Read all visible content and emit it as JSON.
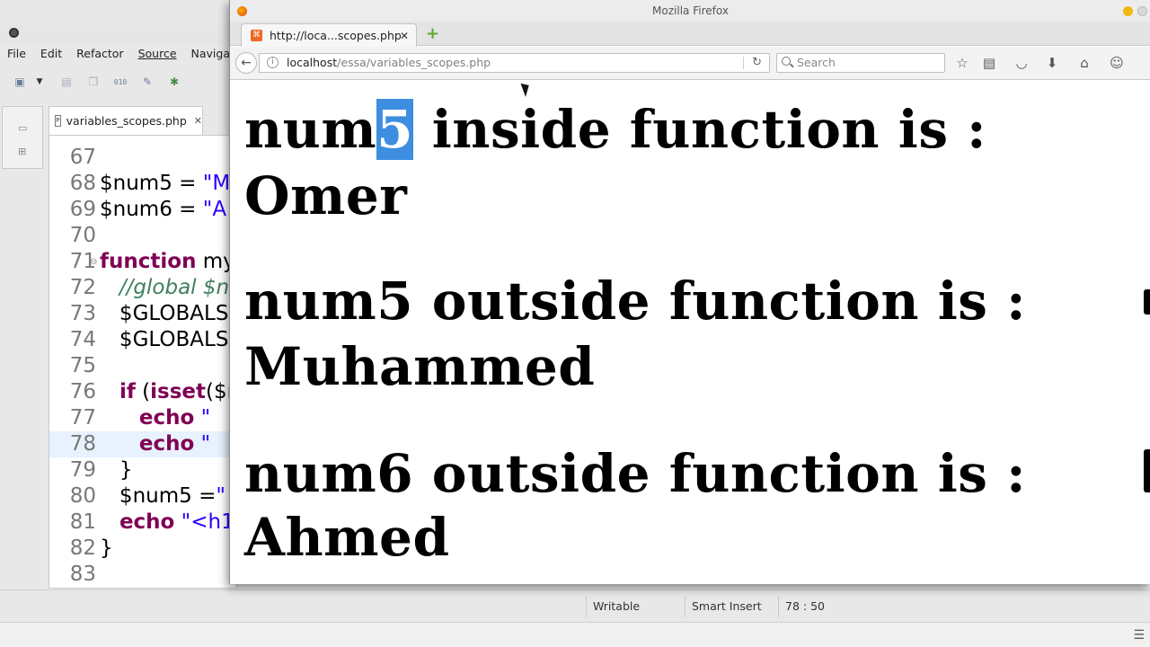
{
  "ide": {
    "menu": [
      "File",
      "Edit",
      "Refactor",
      "Source",
      "Navigate"
    ],
    "editor_tab": "variables_scopes.php",
    "code_lines": [
      {
        "num": "67",
        "parts": []
      },
      {
        "num": "68",
        "parts": [
          {
            "t": "plain",
            "s": "$num5 = "
          },
          {
            "t": "str",
            "s": "\"M"
          }
        ]
      },
      {
        "num": "69",
        "parts": [
          {
            "t": "plain",
            "s": "$num6 = "
          },
          {
            "t": "str",
            "s": "\"A"
          }
        ]
      },
      {
        "num": "70",
        "parts": []
      },
      {
        "num": "71",
        "parts": [
          {
            "t": "kw",
            "s": "function"
          },
          {
            "t": "plain",
            "s": " my"
          }
        ]
      },
      {
        "num": "72",
        "parts": [
          {
            "t": "cmt",
            "s": "   //global $n"
          }
        ]
      },
      {
        "num": "73",
        "parts": [
          {
            "t": "plain",
            "s": "   $GLOBALS"
          }
        ]
      },
      {
        "num": "74",
        "parts": [
          {
            "t": "plain",
            "s": "   $GLOBALS"
          }
        ]
      },
      {
        "num": "75",
        "parts": []
      },
      {
        "num": "76",
        "parts": [
          {
            "t": "plain",
            "s": "   "
          },
          {
            "t": "kw",
            "s": "if"
          },
          {
            "t": "plain",
            "s": " ("
          },
          {
            "t": "kw",
            "s": "isset"
          },
          {
            "t": "plain",
            "s": "($n"
          }
        ]
      },
      {
        "num": "77",
        "parts": [
          {
            "t": "plain",
            "s": "      "
          },
          {
            "t": "kw",
            "s": "echo"
          },
          {
            "t": "plain",
            "s": " "
          },
          {
            "t": "str",
            "s": "\""
          }
        ]
      },
      {
        "num": "78",
        "parts": [
          {
            "t": "plain",
            "s": "      "
          },
          {
            "t": "kw",
            "s": "echo"
          },
          {
            "t": "plain",
            "s": " "
          },
          {
            "t": "str",
            "s": "\""
          }
        ]
      },
      {
        "num": "79",
        "parts": [
          {
            "t": "plain",
            "s": "   }"
          }
        ]
      },
      {
        "num": "80",
        "parts": [
          {
            "t": "plain",
            "s": "   $num5 ="
          },
          {
            "t": "str",
            "s": "\""
          }
        ]
      },
      {
        "num": "81",
        "parts": [
          {
            "t": "plain",
            "s": "   "
          },
          {
            "t": "kw",
            "s": "echo"
          },
          {
            "t": "plain",
            "s": " "
          },
          {
            "t": "str",
            "s": "\"<h1"
          }
        ]
      },
      {
        "num": "82",
        "parts": [
          {
            "t": "plain",
            "s": "}"
          }
        ]
      },
      {
        "num": "83",
        "parts": []
      }
    ],
    "status": {
      "writable": "Writable",
      "insert_mode": "Smart Insert",
      "position": "78 : 50"
    }
  },
  "firefox": {
    "window_title": "Mozilla Firefox",
    "tab_title": "http://loca...scopes.php",
    "url_host": "localhost",
    "url_path": "/essa/variables_scopes.php",
    "search_placeholder": "Search",
    "output": [
      {
        "before": "num",
        "highlight": "5",
        "after": " inside function is :"
      },
      {
        "text": "Omer"
      },
      {
        "text": "num5 outside function is :"
      },
      {
        "text": "Muhammed"
      },
      {
        "text": "num6 outside function is :"
      },
      {
        "text": "Ahmed"
      }
    ]
  },
  "colors": {
    "selection": "#3d8ee0",
    "php_keyword": "#7f0055",
    "php_string": "#2a00ff",
    "php_comment": "#3f7f5f",
    "new_tab_plus": "#58a92d"
  }
}
